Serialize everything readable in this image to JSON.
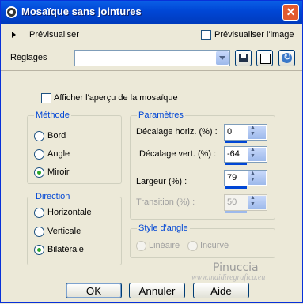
{
  "window": {
    "title": "Mosaïque sans jointures",
    "close_icon": "close-icon",
    "app_icon": "app-icon"
  },
  "preview_bar": {
    "preview_label": "Prévisualiser",
    "preview_image_label": "Prévisualiser l'image",
    "preview_image_checked": false
  },
  "settings": {
    "label": "Réglages",
    "preset_value": "",
    "save_icon": "save-icon",
    "random_icon": "dice-icon",
    "reset_icon": "reset-icon"
  },
  "mosaic_preview": {
    "label": "Afficher l'aperçu de la mosaïque",
    "checked": false
  },
  "method": {
    "title": "Méthode",
    "options": [
      "Bord",
      "Angle",
      "Miroir"
    ],
    "selected": "Miroir"
  },
  "direction": {
    "title": "Direction",
    "options": [
      "Horizontale",
      "Verticale",
      "Bilatérale"
    ],
    "selected": "Bilatérale"
  },
  "parameters": {
    "title": "Paramètres",
    "horiz_label": "Décalage horiz. (%) :",
    "horiz_value": "0",
    "vert_label": "Décalage vert. (%) :",
    "vert_value": "-64",
    "width_label": "Largeur (%) :",
    "width_value": "79",
    "transition_label": "Transition (%) :",
    "transition_value": "50"
  },
  "corner_style": {
    "title": "Style d'angle",
    "options": [
      "Linéaire",
      "Incurvé"
    ]
  },
  "buttons": {
    "ok": "OK",
    "cancel": "Annuler",
    "help": "Aide"
  },
  "watermark": {
    "name": "Pinuccia",
    "site": "www.maidiregrafica.eu"
  }
}
